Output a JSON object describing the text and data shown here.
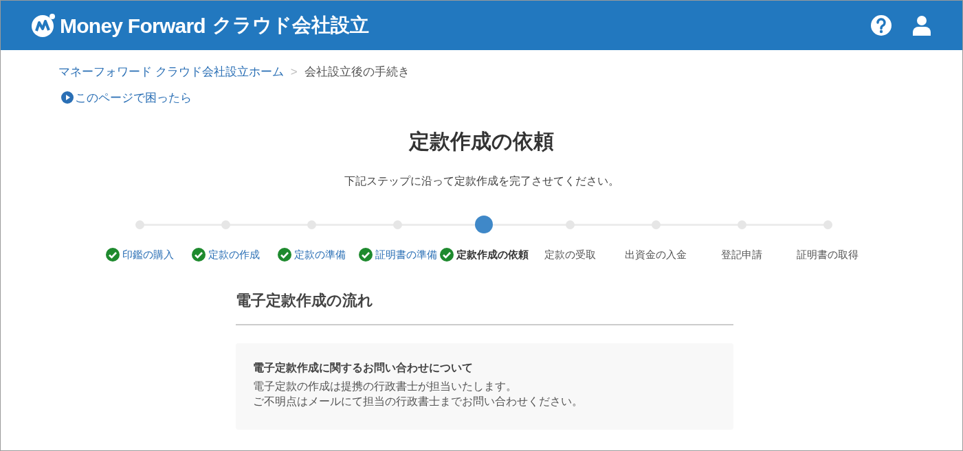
{
  "header": {
    "brand": "Money Forward",
    "product": "クラウド会社設立"
  },
  "breadcrumb": [
    {
      "label": "マネーフォワード クラウド会社設立ホーム",
      "kind": "link"
    },
    {
      "label": ">",
      "kind": "separator"
    },
    {
      "label": "会社設立後の手続き",
      "kind": "current"
    }
  ],
  "help_link": "このページで困ったら",
  "title": "定款作成の依頼",
  "subtitle": "下記ステップに沿って定款作成を完了させてください。",
  "steps": [
    {
      "label": "印鑑の購入",
      "completed": true,
      "selected": false
    },
    {
      "label": "定款の作成",
      "completed": true,
      "selected": false
    },
    {
      "label": "定款の準備",
      "completed": true,
      "selected": false
    },
    {
      "label": "証明書の準備",
      "completed": true,
      "selected": false
    },
    {
      "label": "定款作成の依頼",
      "completed": true,
      "selected": true
    },
    {
      "label": "定款の受取",
      "completed": false,
      "selected": false
    },
    {
      "label": "出資金の入金",
      "completed": false,
      "selected": false
    },
    {
      "label": "登記申請",
      "completed": false,
      "selected": false
    },
    {
      "label": "証明書の取得",
      "completed": false,
      "selected": false
    }
  ],
  "section": {
    "heading": "電子定款作成の流れ",
    "notice": {
      "title": "電子定款作成に関するお問い合わせについて",
      "lines": [
        "電子定款の作成は提携の行政書士が担当いたします。",
        "ご不明点はメールにて担当の行政書士までお問い合わせください。"
      ]
    }
  }
}
